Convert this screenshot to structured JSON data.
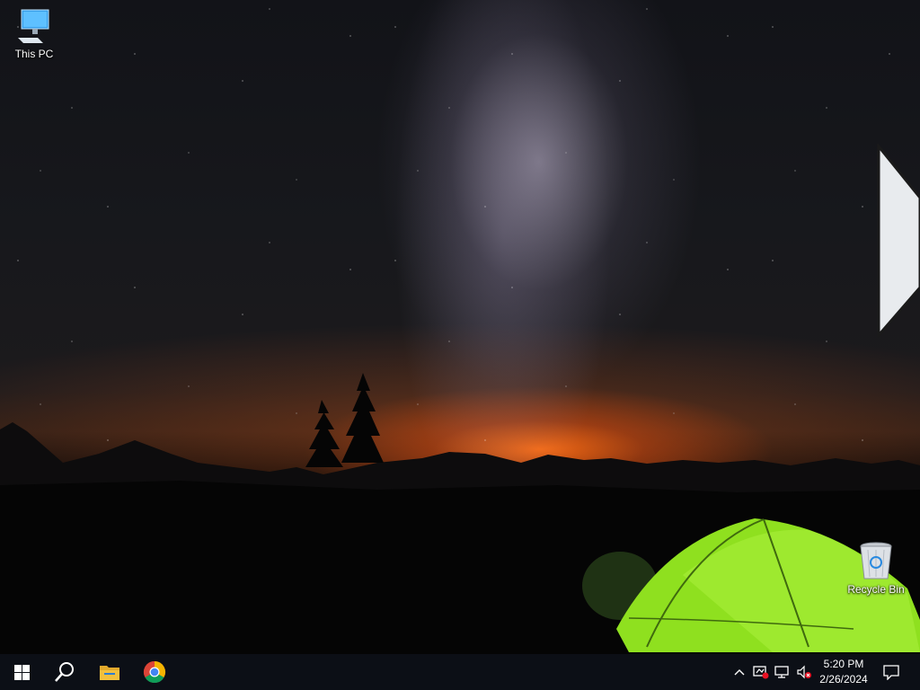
{
  "desktop": {
    "icons": [
      {
        "label": "This PC",
        "icon": "computer-icon"
      },
      {
        "label": "Recycle Bin",
        "icon": "recycle-bin-icon"
      }
    ]
  },
  "taskbar": {
    "pinned": [
      {
        "name": "Start",
        "icon": "windows-logo-icon"
      },
      {
        "name": "Search",
        "icon": "search-icon"
      },
      {
        "name": "File Explorer",
        "icon": "folder-icon"
      },
      {
        "name": "Google Chrome",
        "icon": "chrome-icon"
      }
    ],
    "tray": {
      "icons": [
        "chevron-up-icon",
        "network-warning-icon",
        "network-icon",
        "volume-muted-icon"
      ],
      "time": "5:20 PM",
      "date": "2/26/2024",
      "notification_icon": "action-center-icon"
    }
  },
  "colors": {
    "taskbar_bg": "#0c0f16",
    "tent_green": "#8fe01f",
    "horizon_orange": "#ff6e14",
    "windows_blue": "#ffffff",
    "folder_yellow": "#f3c03c"
  }
}
